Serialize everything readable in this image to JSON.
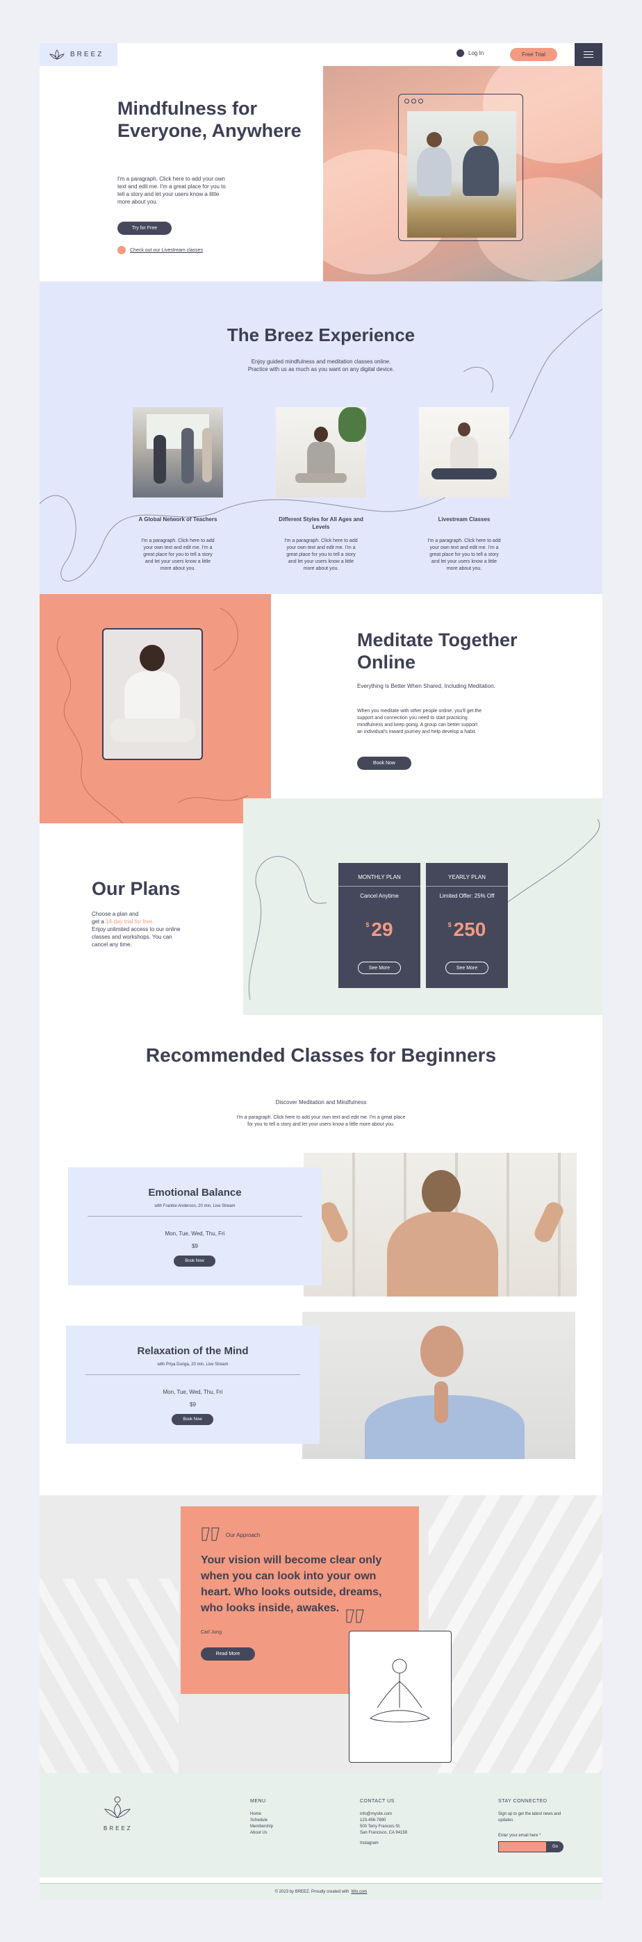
{
  "header": {
    "logo": "BREEZ",
    "login_label": "Log In",
    "trial_label": "Free Trial"
  },
  "hero": {
    "title": "Mindfulness for Everyone, Anywhere",
    "paragraph": "I'm a paragraph. Click here to add your own text and edit me. I'm a great place for you to tell a story and let your users know a little more about you.",
    "cta": "Try for Free",
    "link": "Check out our Livestream classes"
  },
  "experience": {
    "title": "The Breez Experience",
    "subtitle_1": "Enjoy guided mindfulness and meditation classes online.",
    "subtitle_2": "Practice with us as much as you want on any digital device.",
    "features": [
      {
        "title": "A Global Network of Teachers",
        "text": "I'm a paragraph. Click here to add your own text and edit me. I'm a great place for you to tell a story and let your users know a little more about you."
      },
      {
        "title": "Different Styles for All Ages and Levels",
        "text": "I'm a paragraph. Click here to add your own text and edit me. I'm a great place for you to tell a story and let your users know a little more about you."
      },
      {
        "title": "Livestream Classes",
        "text": "I'm a paragraph. Click here to add your own text and edit me. I'm a great place for you to tell a story and let your users know a little more about you."
      }
    ]
  },
  "meditate": {
    "title": "Meditate Together Online",
    "subtitle": "Everything Is Better When Shared, Including Meditation.",
    "paragraph": "When you meditate with other people online, you'll get the support and connection you need to start practicing mindfulness and keep going. A group can better support an individual's inward journey and help develop a habit.",
    "cta": "Book Now"
  },
  "plans": {
    "title": "Our Plans",
    "para_1": "Choose a plan and",
    "para_2": "get a",
    "para_accent": "14-day trial for free.",
    "para_3": "Enjoy unlimited access to our online classes and workshops. You can cancel any time.",
    "items": [
      {
        "name": "MONTHLY PLAN",
        "note": "Cancel Anytime",
        "currency": "$",
        "price": "29",
        "cta": "See More"
      },
      {
        "name": "YEARLY PLAN",
        "note": "Limited Offer: 25% Off",
        "currency": "$",
        "price": "250",
        "cta": "See More"
      }
    ]
  },
  "recommended": {
    "title": "Recommended Classes for Beginners",
    "subtitle": "Discover Meditation and Mindfulness",
    "paragraph": "I'm a paragraph. Click here to add your own text and edit me. I'm a great place for you to tell a story and let your users know a little more about you.",
    "classes": [
      {
        "title": "Emotional Balance",
        "meta": "with Frankie Anderson, 20 min, Live Stream",
        "days": "Mon, Tue, Wed, Thu, Fri",
        "price": "$9",
        "cta": "Book Now"
      },
      {
        "title": "Relaxation of the Mind",
        "meta": "with Priya Dunga, 20 min, Live Stream",
        "days": "Mon, Tue, Wed, Thu, Fri",
        "price": "$9",
        "cta": "Book Now"
      }
    ]
  },
  "approach": {
    "tag": "Our Approach",
    "quote": "Your vision will become clear only when you can look into your own heart. Who looks outside, dreams, who looks inside, awakes.",
    "author": "Carl Jung",
    "cta": "Read More"
  },
  "footer": {
    "logo": "BREEZ",
    "menu_title": "MENU",
    "menu": [
      "Home",
      "Schedule",
      "Membership",
      "About Us"
    ],
    "contact_title": "CONTACT US",
    "contact": [
      "info@mysite.com",
      "123-456-7890",
      "500 Terry Francois St.",
      "San Francisco, CA 94158"
    ],
    "instagram": "Instagram",
    "connected_title": "STAY CONNECTED",
    "connected_text": "Sign up to get the latest news and updates",
    "email_label": "Enter your email here *",
    "go": "Go",
    "copyright": "© 2023 by BREEZ. Proudly created with",
    "wix": "Wix.com"
  },
  "colors": {
    "accent": "#f29b82",
    "dark": "#3d3f53",
    "lavender": "#e3e7fc",
    "mint": "#e7f0ea"
  }
}
